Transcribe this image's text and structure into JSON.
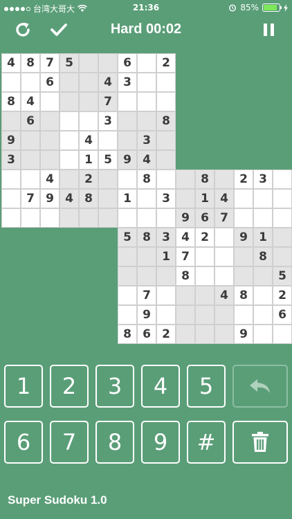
{
  "status_bar": {
    "carrier": "台湾大哥大",
    "time": "21:36",
    "battery": "85%"
  },
  "toolbar": {
    "title": "Hard 00:02"
  },
  "boards": [
    {
      "grid": [
        "4875  6 2",
        "  6  43  ",
        "84   7   ",
        " 6   3  8",
        "9   4  3 ",
        "3   1594 ",
        "  4 2  8 ",
        " 7948 1 3",
        "         "
      ]
    },
    {
      "grid": [
        "    8 23 ",
        "    14   ",
        " 3 967   ",
        "58342 91 ",
        "  17   8 ",
        "   8    5",
        " 7   48 2",
        " 9      6",
        "862   9  "
      ]
    }
  ],
  "keypad": {
    "row1": [
      "1",
      "2",
      "3",
      "4",
      "5"
    ],
    "row2": [
      "6",
      "7",
      "8",
      "9",
      "#"
    ]
  },
  "footer": {
    "app_name": "Super Sudoku 1.0"
  }
}
